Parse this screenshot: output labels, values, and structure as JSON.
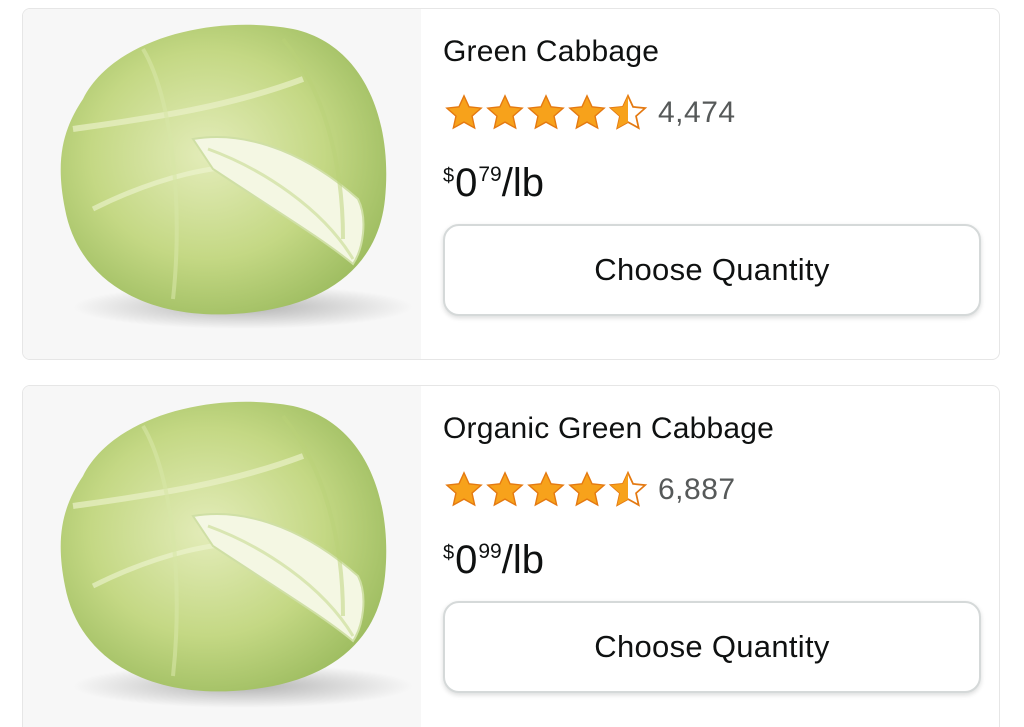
{
  "products": [
    {
      "title": "Green Cabbage",
      "rating": 4.5,
      "rating_count": "4,474",
      "price": {
        "symbol": "$",
        "whole": "0",
        "fraction": "79",
        "unit": "/lb"
      },
      "button_label": "Choose Quantity",
      "image_icon": "cabbage-image"
    },
    {
      "title": "Organic Green Cabbage",
      "rating": 4.5,
      "rating_count": "6,887",
      "price": {
        "symbol": "$",
        "whole": "0",
        "fraction": "99",
        "unit": "/lb"
      },
      "button_label": "Choose Quantity",
      "image_icon": "cabbage-image"
    }
  ],
  "colors": {
    "star_fill": "#F7A21B",
    "star_stroke": "#E47911",
    "text_primary": "#0F1111",
    "text_secondary": "#565959",
    "button_border": "#D5D9D9",
    "image_background": "#F7F7F7"
  }
}
